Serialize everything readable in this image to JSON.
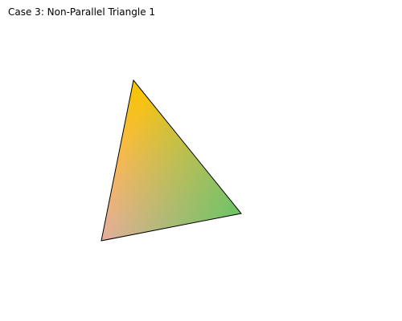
{
  "title": "Case 3: Non-Parallel Triangle 1",
  "triangle": {
    "vertex_colors": {
      "top": "#f7c600",
      "right": "#6cc466",
      "bottom_left": "#f5aaa6"
    },
    "stroke_color": "#000000"
  }
}
